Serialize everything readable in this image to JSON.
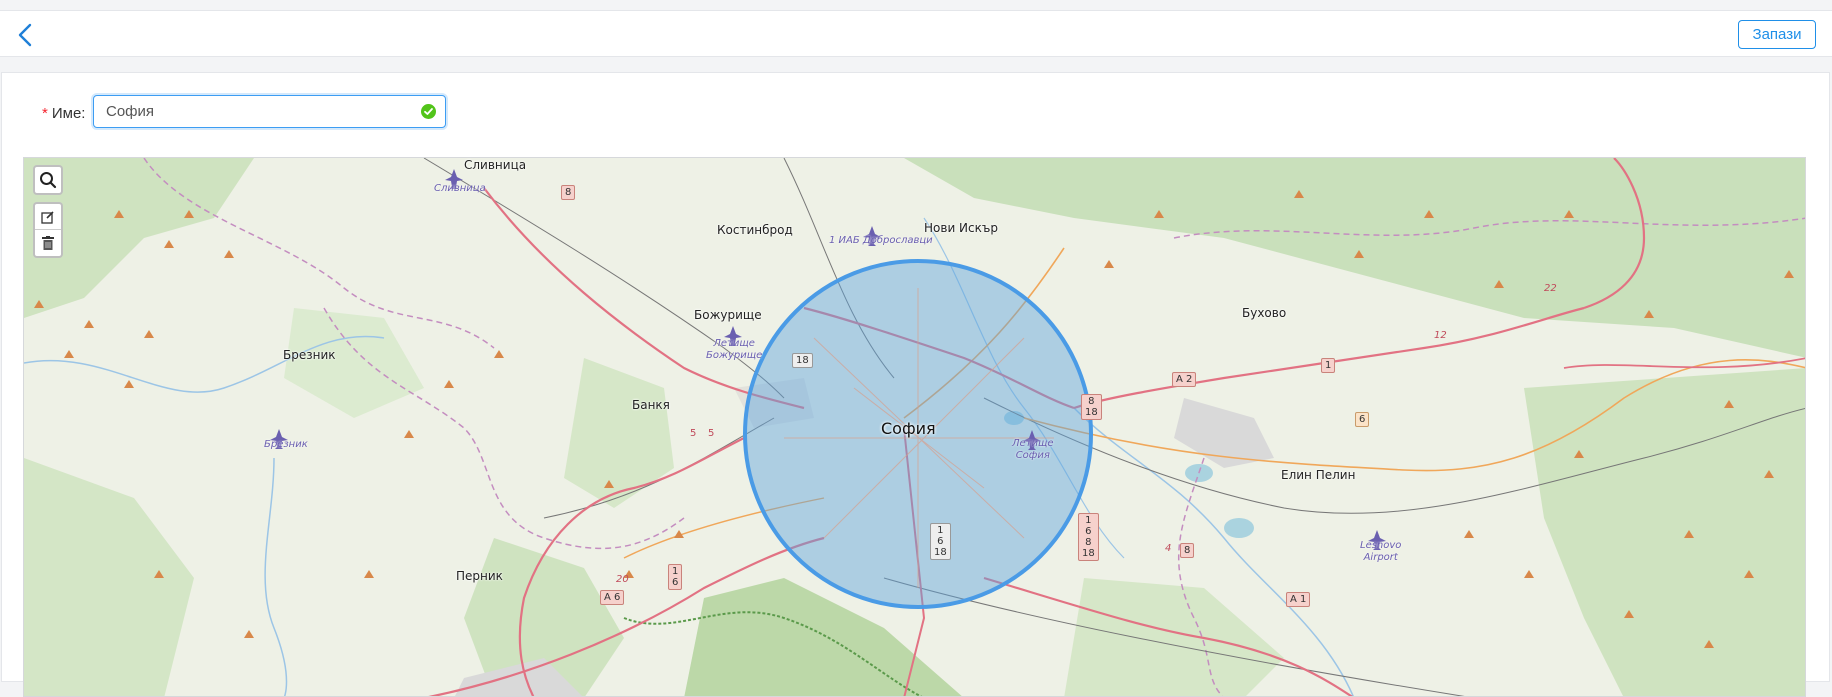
{
  "header": {
    "save_label": "Запази"
  },
  "form": {
    "name_label": "Име",
    "name_value": "София"
  },
  "map": {
    "city": "София",
    "towns": [
      "Сливница",
      "Костинброд",
      "Нови Искър",
      "Божурище",
      "Брезник",
      "Банкя",
      "Бухово",
      "Елин Пелин",
      "Перник"
    ],
    "airports": [
      "Сливница",
      "1 ИАБ Доброславци",
      "Летище\nБожурище",
      "Брезник",
      "Летище\nСофия",
      "Lesnovo\nAirport"
    ],
    "roads": [
      "8",
      "18",
      "A 2",
      "1",
      "6",
      "12",
      "22",
      "5",
      "5",
      "1\n6\n18",
      "1\n6\n8\n18",
      "8\n18",
      "8",
      "4",
      "20",
      "1\n6",
      "A 6",
      "A 1"
    ]
  }
}
